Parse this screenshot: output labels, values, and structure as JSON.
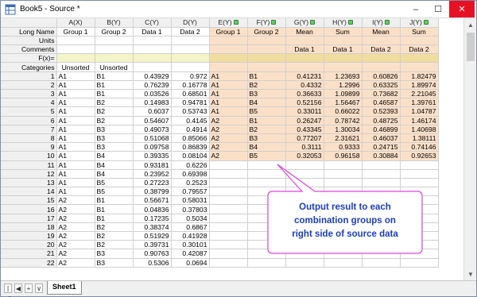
{
  "window": {
    "title": "Book5 - Source *",
    "min": "–",
    "max": "☐",
    "close": "✕"
  },
  "columns": [
    {
      "name": "A(X)",
      "locked": false,
      "long_name": "Group 1",
      "units": "",
      "comments": "",
      "result": false
    },
    {
      "name": "B(Y)",
      "locked": false,
      "long_name": "Group 2",
      "units": "",
      "comments": "",
      "result": false
    },
    {
      "name": "C(Y)",
      "locked": false,
      "long_name": "Data 1",
      "units": "",
      "comments": "",
      "result": false
    },
    {
      "name": "D(Y)",
      "locked": false,
      "long_name": "Data 2",
      "units": "",
      "comments": "",
      "result": false
    },
    {
      "name": "E(Y)",
      "locked": true,
      "long_name": "Group 1",
      "units": "",
      "comments": "",
      "result": true
    },
    {
      "name": "F(Y)",
      "locked": true,
      "long_name": "Group 2",
      "units": "",
      "comments": "",
      "result": true
    },
    {
      "name": "G(Y)",
      "locked": true,
      "long_name": "Mean",
      "units": "",
      "comments": "Data 1",
      "result": true
    },
    {
      "name": "H(Y)",
      "locked": true,
      "long_name": "Sum",
      "units": "",
      "comments": "Data 1",
      "result": true
    },
    {
      "name": "I(Y)",
      "locked": true,
      "long_name": "Mean",
      "units": "",
      "comments": "Data 2",
      "result": true
    },
    {
      "name": "J(Y)",
      "locked": true,
      "long_name": "Sum",
      "units": "",
      "comments": "Data 2",
      "result": true
    }
  ],
  "meta_rows": {
    "long_name": "Long Name",
    "units": "Units",
    "comments": "Comments",
    "fx": "F(x)=",
    "categories": "Categories",
    "categories_values": [
      "Unsorted",
      "Unsorted"
    ]
  },
  "rows": [
    [
      "A1",
      "B1",
      "0.43929",
      "0.972",
      "A1",
      "B1",
      "0.41231",
      "1.23693",
      "0.60826",
      "1.82479"
    ],
    [
      "A1",
      "B1",
      "0.76239",
      "0.16778",
      "A1",
      "B2",
      "0.4332",
      "1.2996",
      "0.63325",
      "1.89974"
    ],
    [
      "A1",
      "B1",
      "0.03526",
      "0.68501",
      "A1",
      "B3",
      "0.36633",
      "1.09899",
      "0.73682",
      "2.21045"
    ],
    [
      "A1",
      "B2",
      "0.14983",
      "0.94781",
      "A1",
      "B4",
      "0.52156",
      "1.56467",
      "0.46587",
      "1.39761"
    ],
    [
      "A1",
      "B2",
      "0.6037",
      "0.53743",
      "A1",
      "B5",
      "0.33011",
      "0.66022",
      "0.52393",
      "1.04787"
    ],
    [
      "A1",
      "B2",
      "0.54607",
      "0.4145",
      "A2",
      "B1",
      "0.26247",
      "0.78742",
      "0.48725",
      "1.46174"
    ],
    [
      "A1",
      "B3",
      "0.49073",
      "0.4914",
      "A2",
      "B2",
      "0.43345",
      "1.30034",
      "0.46899",
      "1.40698"
    ],
    [
      "A1",
      "B3",
      "0.51068",
      "0.85066",
      "A2",
      "B3",
      "0.77207",
      "2.31621",
      "0.46037",
      "1.38111"
    ],
    [
      "A1",
      "B3",
      "0.09758",
      "0.86839",
      "A2",
      "B4",
      "0.3111",
      "0.9333",
      "0.24715",
      "0.74146"
    ],
    [
      "A1",
      "B4",
      "0.39335",
      "0.08104",
      "A2",
      "B5",
      "0.32053",
      "0.96158",
      "0.30884",
      "0.92653"
    ],
    [
      "A1",
      "B4",
      "0.93181",
      "0.6226",
      "",
      "",
      "",
      "",
      "",
      ""
    ],
    [
      "A1",
      "B4",
      "0.23952",
      "0.69398",
      "",
      "",
      "",
      "",
      "",
      ""
    ],
    [
      "A1",
      "B5",
      "0.27223",
      "0.2523",
      "",
      "",
      "",
      "",
      "",
      ""
    ],
    [
      "A1",
      "B5",
      "0.38799",
      "0.79557",
      "",
      "",
      "",
      "",
      "",
      ""
    ],
    [
      "A2",
      "B1",
      "0.56671",
      "0.58031",
      "",
      "",
      "",
      "",
      "",
      ""
    ],
    [
      "A2",
      "B1",
      "0.04836",
      "0.37803",
      "",
      "",
      "",
      "",
      "",
      ""
    ],
    [
      "A2",
      "B1",
      "0.17235",
      "0.5034",
      "",
      "",
      "",
      "",
      "",
      ""
    ],
    [
      "A2",
      "B2",
      "0.38374",
      "0.6867",
      "",
      "",
      "",
      "",
      "",
      ""
    ],
    [
      "A2",
      "B2",
      "0.51929",
      "0.41928",
      "",
      "",
      "",
      "",
      "",
      ""
    ],
    [
      "A2",
      "B2",
      "0.39731",
      "0.30101",
      "",
      "",
      "",
      "",
      "",
      ""
    ],
    [
      "A2",
      "B3",
      "0.90763",
      "0.42087",
      "",
      "",
      "",
      "",
      "",
      ""
    ],
    [
      "A2",
      "B3",
      "0.5306",
      "0.0694",
      "",
      "",
      "",
      "",
      "",
      ""
    ]
  ],
  "bottom": {
    "nav_first": "|◀",
    "nav_prev": "◀",
    "nav_add": "+",
    "nav_list": "∨",
    "sheet_tab": "Sheet1"
  },
  "annotation": {
    "line1": "Output result to each",
    "line2": "combination groups on",
    "line3": "right side of source data",
    "border_color": "#e040e0"
  },
  "colors": {
    "result_fill": "#fbe0c8",
    "fx_src": "#f4f4c8",
    "fx_res": "#f0dda0",
    "callout_text": "#1a3fb8"
  }
}
